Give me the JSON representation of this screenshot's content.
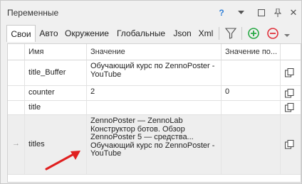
{
  "window": {
    "title": "Переменные"
  },
  "titlebar_icons": {
    "help": "?",
    "dropdown": "▾",
    "maximize": "□",
    "pin": "pin-icon",
    "close": "✕"
  },
  "tabs": [
    "Свои",
    "Авто",
    "Окружение",
    "Глобальные",
    "Json",
    "Xml"
  ],
  "toolbar": {
    "filter": "filter-icon",
    "add": "add-icon",
    "remove": "remove-icon",
    "more": "▾"
  },
  "columns": {
    "name": "Имя",
    "value": "Значение",
    "default": "Значение по..."
  },
  "rows": [
    {
      "name": "title_Buffer",
      "value_lines": [
        "Обучающий курс по ZennoPoster -",
        "YouTube"
      ],
      "default": ""
    },
    {
      "name": "counter",
      "value_lines": [
        "2"
      ],
      "default": "0"
    },
    {
      "name": "title",
      "value_lines": [
        ""
      ],
      "default": ""
    },
    {
      "name": "titles",
      "value_lines": [
        "ZennoPoster — ZennoLab",
        "Конструктор ботов. Обзор",
        "ZennoPoster 5 — средства...",
        "Обучающий курс по ZennoPoster -",
        "YouTube"
      ],
      "default": "",
      "row_marker": "→"
    }
  ],
  "colors": {
    "accent_help": "#2f7fd7",
    "add": "#27a844",
    "remove": "#e0323c",
    "annotation_arrow": "#e02020",
    "selected_row": "#eeeeee"
  }
}
